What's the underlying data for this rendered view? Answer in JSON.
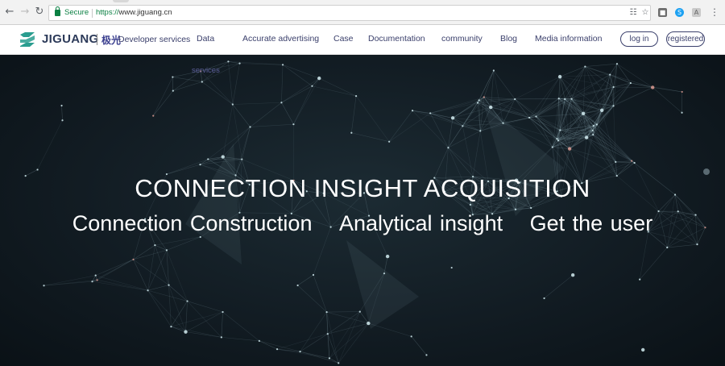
{
  "browser": {
    "back_icon": "arrow-left-icon",
    "forward_icon": "arrow-right-icon",
    "reload_icon": "reload-icon",
    "secure_label": "Secure",
    "url_scheme": "https://",
    "url_host": "www.jiguang.cn",
    "translate_icon": "translate-icon",
    "star_icon": "star-icon",
    "menu_icon": "kebab-menu-icon"
  },
  "header": {
    "logo_text": "JIGUANG",
    "logo_cn": "极光",
    "developer_services": "Developer services",
    "nav": [
      {
        "label": "Data"
      },
      {
        "label": "Accurate advertising"
      },
      {
        "label": "Case"
      },
      {
        "label": "Documentation"
      },
      {
        "label": "community"
      },
      {
        "label": "Blog"
      },
      {
        "label": "Media information"
      }
    ],
    "data_sub": "services",
    "login_label": "log in",
    "register_label": "registered",
    "brand_color": "#3a3f6b",
    "logo_color": "#2a9d8f"
  },
  "hero": {
    "title": "CONNECTION INSIGHT ACQUISITION",
    "sub_1": "Connection Construction",
    "sub_2": "Analytical insight",
    "sub_3": "Get the user",
    "background_color": "#121c23"
  }
}
